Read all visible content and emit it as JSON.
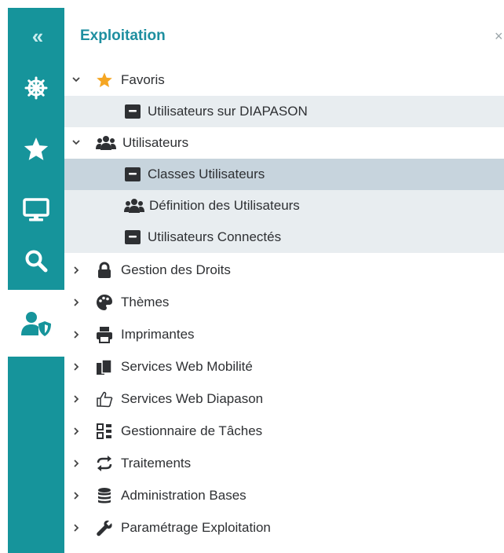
{
  "rail": {
    "items": [
      {
        "name": "collapse",
        "icon": "double-chevron-left-icon"
      },
      {
        "name": "wheel",
        "icon": "ship-wheel-icon"
      },
      {
        "name": "favorites",
        "icon": "star-icon"
      },
      {
        "name": "monitor",
        "icon": "monitor-icon"
      },
      {
        "name": "search",
        "icon": "search-icon"
      },
      {
        "name": "user-admin",
        "icon": "user-shield-icon",
        "active": true
      }
    ],
    "collapse_glyph": "«"
  },
  "panel": {
    "title": "Exploitation",
    "close": "×"
  },
  "tree": [
    {
      "label": "Favoris",
      "expanded": true,
      "icon": "star-icon"
    },
    {
      "label": "Utilisateurs sur DIAPASON",
      "icon": "window-icon"
    },
    {
      "label": "Utilisateurs",
      "expanded": true,
      "icon": "users-icon"
    },
    {
      "label": "Classes Utilisateurs",
      "icon": "window-icon",
      "selected": true
    },
    {
      "label": "Définition des Utilisateurs",
      "icon": "users-icon"
    },
    {
      "label": "Utilisateurs Connectés",
      "icon": "window-icon"
    },
    {
      "label": "Gestion des Droits",
      "icon": "lock-icon"
    },
    {
      "label": "Thèmes",
      "icon": "palette-icon"
    },
    {
      "label": "Imprimantes",
      "icon": "printer-icon"
    },
    {
      "label": "Services Web Mobilité",
      "icon": "copy-icon"
    },
    {
      "label": "Services Web Diapason",
      "icon": "hand-pointer-icon"
    },
    {
      "label": "Gestionnaire de Tâches",
      "icon": "task-grid-icon"
    },
    {
      "label": "Traitements",
      "icon": "exchange-arrows-icon"
    },
    {
      "label": "Administration  Bases",
      "icon": "database-icon"
    },
    {
      "label": "Paramétrage Exploitation",
      "icon": "wrench-icon"
    }
  ],
  "colors": {
    "rail": "#16949b",
    "title": "#1e8fa0",
    "star": "#f5a623",
    "icon_dark": "#2e3033",
    "selected_row": "#c7d4dd",
    "child_row": "#e8edf0",
    "highlight": "#e9f57a"
  }
}
